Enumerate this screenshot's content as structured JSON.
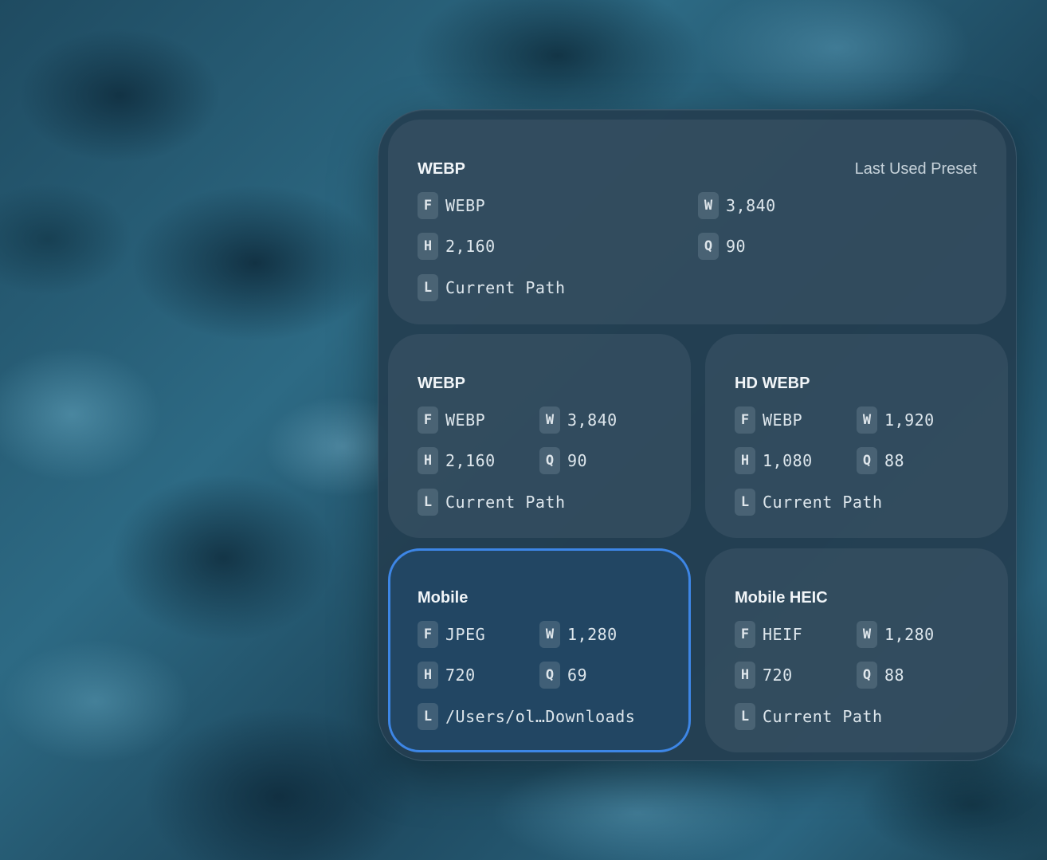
{
  "last_used": {
    "title": "WEBP",
    "note": "Last Used Preset",
    "fields": {
      "format": {
        "key": "F",
        "value": "WEBP"
      },
      "width": {
        "key": "W",
        "value": "3,840"
      },
      "height": {
        "key": "H",
        "value": "2,160"
      },
      "quality": {
        "key": "Q",
        "value": "90"
      },
      "location": {
        "key": "L",
        "value": "Current Path"
      }
    }
  },
  "presets": [
    {
      "title": "WEBP",
      "selected": false,
      "fields": {
        "format": {
          "key": "F",
          "value": "WEBP"
        },
        "width": {
          "key": "W",
          "value": "3,840"
        },
        "height": {
          "key": "H",
          "value": "2,160"
        },
        "quality": {
          "key": "Q",
          "value": "90"
        },
        "location": {
          "key": "L",
          "value": "Current Path"
        }
      }
    },
    {
      "title": "HD WEBP",
      "selected": false,
      "fields": {
        "format": {
          "key": "F",
          "value": "WEBP"
        },
        "width": {
          "key": "W",
          "value": "1,920"
        },
        "height": {
          "key": "H",
          "value": "1,080"
        },
        "quality": {
          "key": "Q",
          "value": "88"
        },
        "location": {
          "key": "L",
          "value": "Current Path"
        }
      }
    },
    {
      "title": "Mobile",
      "selected": true,
      "fields": {
        "format": {
          "key": "F",
          "value": "JPEG"
        },
        "width": {
          "key": "W",
          "value": "1,280"
        },
        "height": {
          "key": "H",
          "value": "720"
        },
        "quality": {
          "key": "Q",
          "value": "69"
        },
        "location": {
          "key": "L",
          "value": "/Users/ol…Downloads"
        }
      }
    },
    {
      "title": "Mobile HEIC",
      "selected": false,
      "fields": {
        "format": {
          "key": "F",
          "value": "HEIF"
        },
        "width": {
          "key": "W",
          "value": "1,280"
        },
        "height": {
          "key": "H",
          "value": "720"
        },
        "quality": {
          "key": "Q",
          "value": "88"
        },
        "location": {
          "key": "L",
          "value": "Current Path"
        }
      }
    }
  ],
  "colors": {
    "selection_border": "#3d86e6",
    "panel_background": "#243e50",
    "card_background": "#3e5668"
  }
}
